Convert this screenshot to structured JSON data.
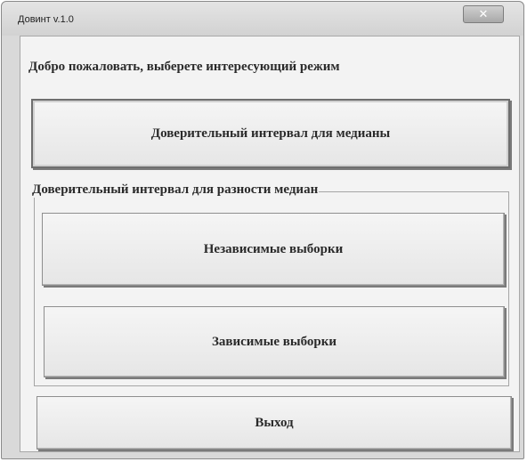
{
  "window": {
    "title": "Довинт v.1.0",
    "close_symbol": "✕"
  },
  "welcome_text": "Добро пожаловать, выберете интересующий режим",
  "buttons": {
    "median_interval": "Доверительный интервал для медианы",
    "independent_samples": "Независимые выборки",
    "dependent_samples": "Зависимые выборки",
    "exit": "Выход"
  },
  "group": {
    "title": "Доверительный интервал для разности медиан"
  }
}
